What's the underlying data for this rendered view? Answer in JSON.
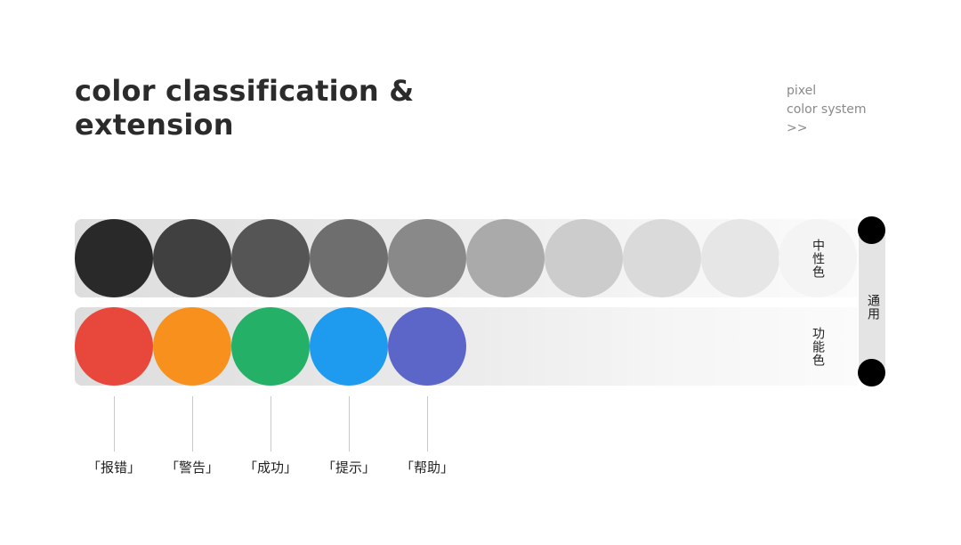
{
  "header": {
    "title_line1": "color classification &",
    "title_line2": "extension",
    "subtitle_lines": [
      "pixel",
      "color system",
      ">>"
    ]
  },
  "neutral": {
    "label": "中性色",
    "swatches": [
      {
        "name": "neutral-1",
        "color": "#292929"
      },
      {
        "name": "neutral-2",
        "color": "#404040"
      },
      {
        "name": "neutral-3",
        "color": "#555555"
      },
      {
        "name": "neutral-4",
        "color": "#6e6e6e"
      },
      {
        "name": "neutral-5",
        "color": "#898989"
      },
      {
        "name": "neutral-6",
        "color": "#aaaaaa"
      },
      {
        "name": "neutral-7",
        "color": "#cccccc"
      },
      {
        "name": "neutral-8",
        "color": "#dadada"
      },
      {
        "name": "neutral-9",
        "color": "#e6e6e6"
      }
    ]
  },
  "functional": {
    "label": "功能色",
    "swatches": [
      {
        "name": "error",
        "color": "#e8483b",
        "label": "「报错」"
      },
      {
        "name": "warning",
        "color": "#f8901e",
        "label": "「警告」"
      },
      {
        "name": "success",
        "color": "#24b066",
        "label": "「成功」"
      },
      {
        "name": "info",
        "color": "#1e9bee",
        "label": "「提示」"
      },
      {
        "name": "help",
        "color": "#5c66c8",
        "label": "「帮助」"
      }
    ]
  },
  "rail": {
    "label": "通用"
  }
}
